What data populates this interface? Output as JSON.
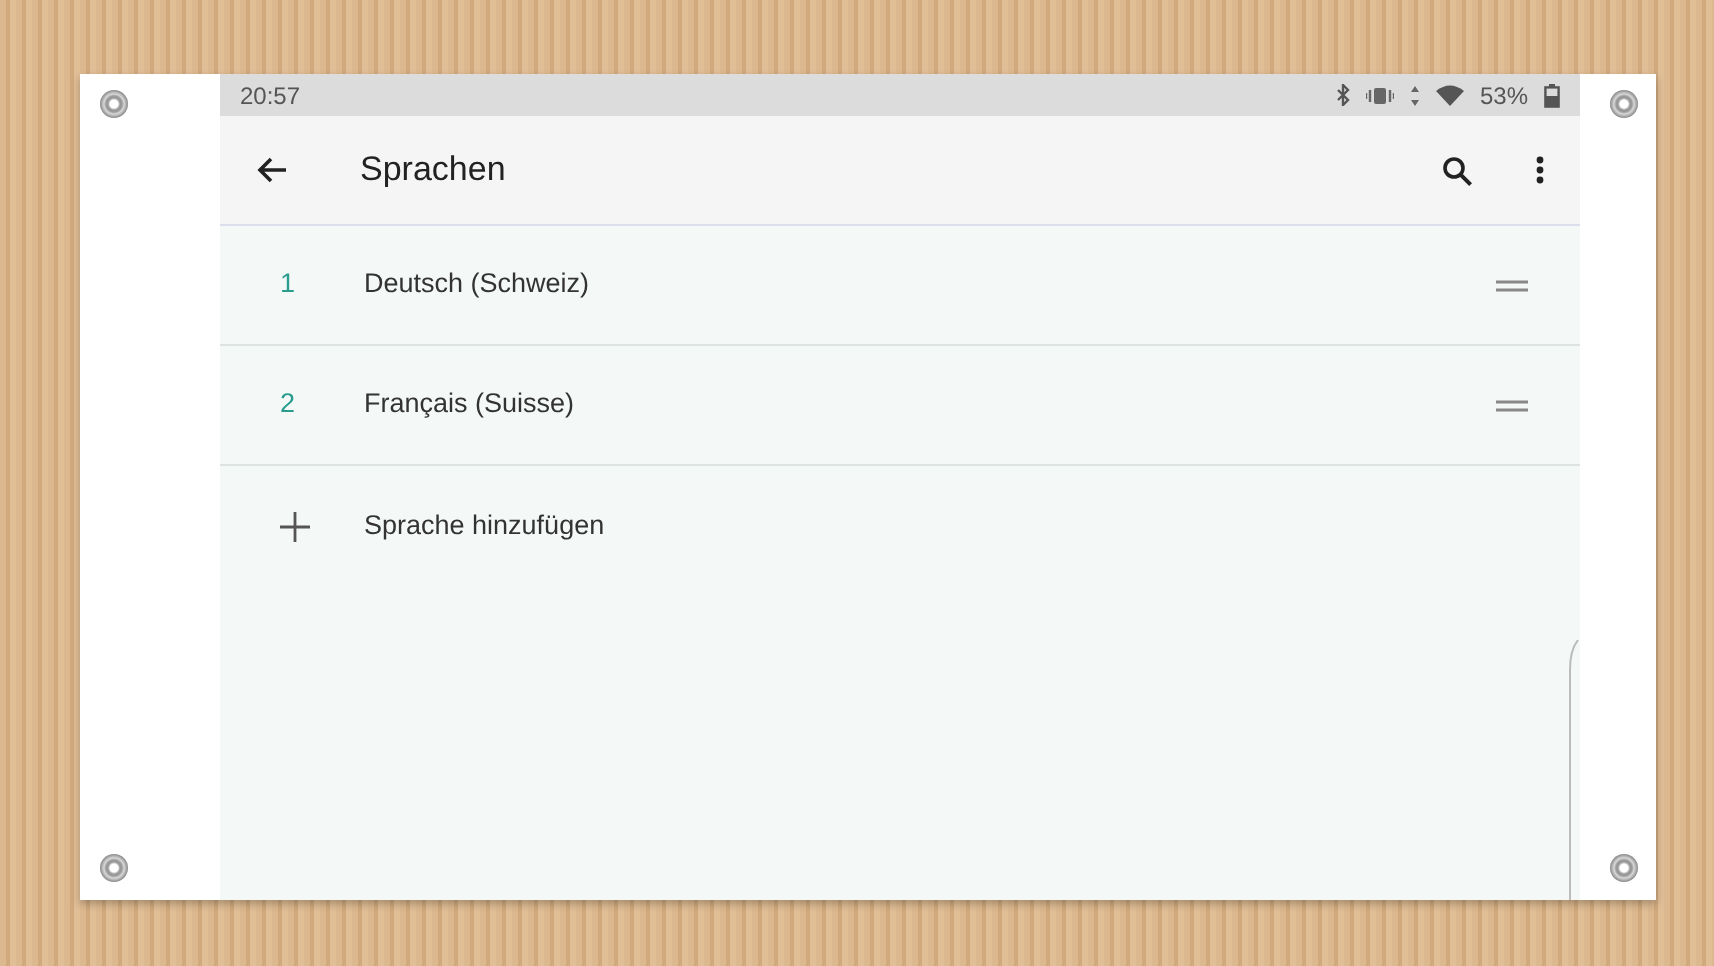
{
  "status_bar": {
    "time": "20:57",
    "battery": "53%"
  },
  "app_bar": {
    "title": "Sprachen"
  },
  "languages": [
    {
      "number": "1",
      "name": "Deutsch (Schweiz)"
    },
    {
      "number": "2",
      "name": "Français (Suisse)"
    }
  ],
  "add_action": {
    "label": "Sprache hinzufügen"
  }
}
